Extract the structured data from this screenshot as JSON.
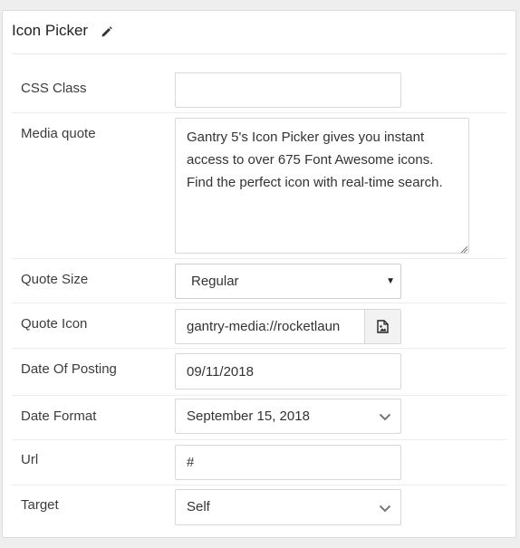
{
  "panel": {
    "title": "Icon Picker"
  },
  "fields": {
    "css_class": {
      "label": "CSS Class",
      "value": ""
    },
    "media_quote": {
      "label": "Media quote",
      "value": "Gantry 5's Icon Picker gives you instant access to over 675 Font Awesome icons. Find the perfect icon with real-time search."
    },
    "quote_size": {
      "label": "Quote Size",
      "value": "Regular"
    },
    "quote_icon": {
      "label": "Quote Icon",
      "value": "gantry-media://rocketlaun"
    },
    "date_of_posting": {
      "label": "Date Of Posting",
      "value": "09/11/2018"
    },
    "date_format": {
      "label": "Date Format",
      "value": "September 15, 2018"
    },
    "url": {
      "label": "Url",
      "value": "#"
    },
    "target": {
      "label": "Target",
      "value": "Self"
    }
  },
  "icons": {
    "title_edit": "pencil-icon",
    "quote_icon_picker": "image-file-icon",
    "select_caret": "caret-down-icon",
    "dropdown_chevron": "chevron-down-icon"
  },
  "colors": {
    "background": "#eeeeee",
    "panel": "#ffffff",
    "border": "#d8d8d8",
    "text": "#333333"
  }
}
